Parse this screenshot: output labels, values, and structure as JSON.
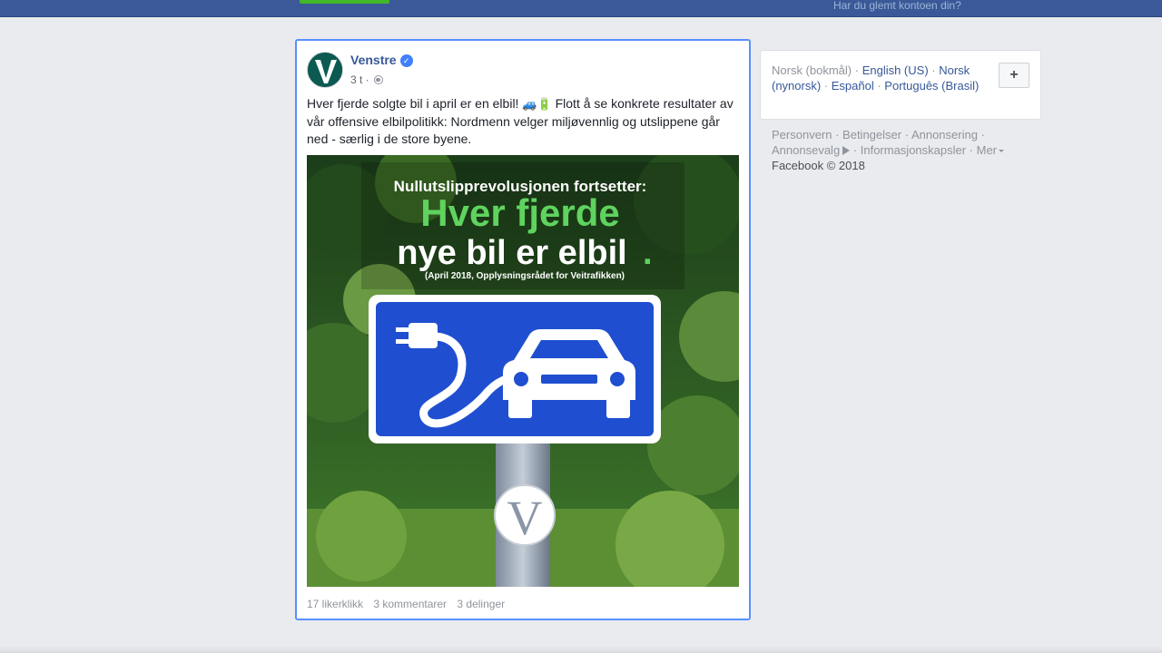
{
  "topbar": {
    "forgot_account": "Har du glemt kontoen din?"
  },
  "post": {
    "page_name": "Venstre",
    "time": "3 t ·",
    "text_part1": "Hver fjerde solgte bil i april er en elbil! ",
    "emojis": "🚙🔋",
    "text_part2": " Flott å se konkrete resultater av vår offensive elbilpolitikk: Nordmenn velger miljøvennlig og utslippene går ned - særlig i de store byene.",
    "image": {
      "line1": "Nullutslipprevolusjonen fortsetter:",
      "line2": "Hver fjerde",
      "line3": "nye bil er elbil",
      "line3_dot": ".",
      "source": "(April 2018, Opplysningsrådet for Veitrafikken)",
      "logo_letter": "V"
    },
    "likes": "17 likerklikk",
    "comments": "3 kommentarer",
    "shares": "3 delinger"
  },
  "languages": {
    "current": "Norsk (bokmål)",
    "english": "English (US)",
    "nynorsk": "Norsk (nynorsk)",
    "spanish": "Español",
    "portuguese": "Português (Brasil)",
    "add_label": "+"
  },
  "footer": {
    "privacy": "Personvern",
    "terms": "Betingelser",
    "advertising": "Annonsering",
    "adchoices": "Annonsevalg",
    "cookies": "Informasjonskapsler",
    "more": "Mer",
    "copyright": "Facebook © 2018"
  },
  "colors": {
    "facebook_blue": "#3b5998",
    "link_blue": "#365899",
    "highlight_border": "#5890ff",
    "venstre_green": "#0c5a52",
    "sign_blue": "#1f4fd0",
    "accent_green": "#5fd35f"
  }
}
